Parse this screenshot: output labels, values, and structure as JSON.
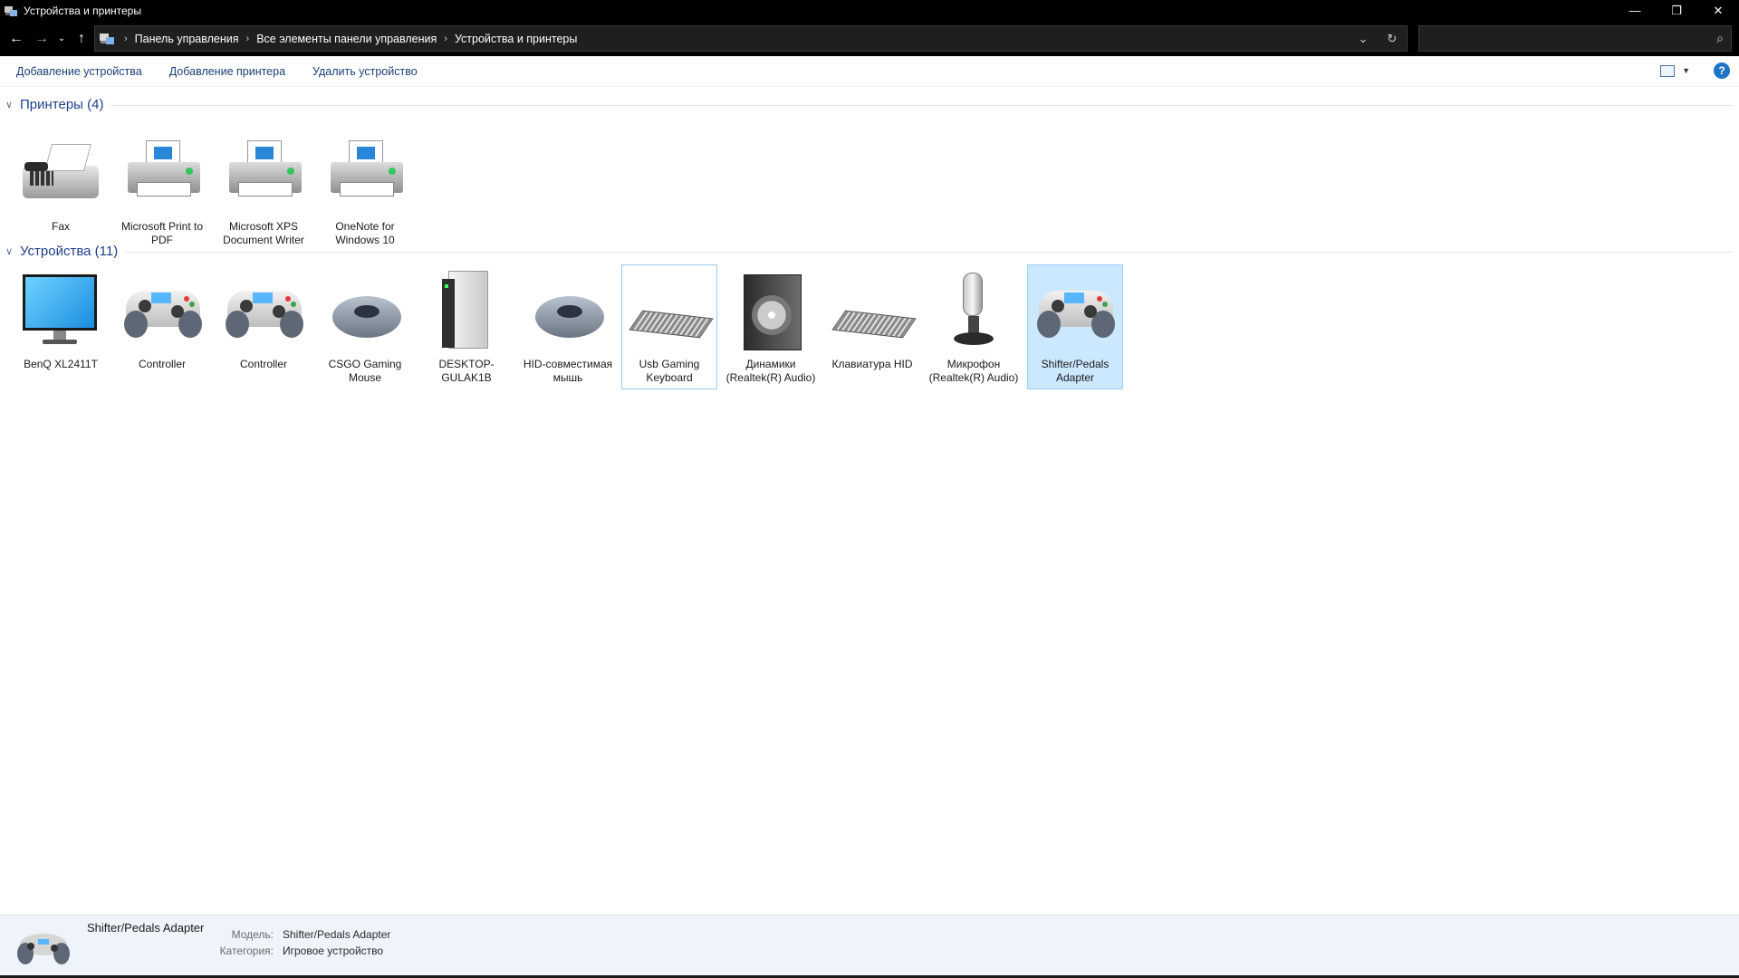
{
  "window": {
    "title": "Устройства и принтеры",
    "controls": {
      "minimize": "—",
      "restore": "❐",
      "close": "✕"
    }
  },
  "address_bar": {
    "breadcrumbs": [
      "Панель управления",
      "Все элементы панели управления",
      "Устройства и принтеры"
    ],
    "separator": "›",
    "search_placeholder": ""
  },
  "command_bar": {
    "add_device": "Добавление устройства",
    "add_printer": "Добавление принтера",
    "remove_device": "Удалить устройство",
    "help": "?"
  },
  "groups": {
    "printers": {
      "label": "Принтеры (4)",
      "items": [
        {
          "label": "Fax",
          "icon": "fax-icon"
        },
        {
          "label": "Microsoft Print to PDF",
          "icon": "printer-icon"
        },
        {
          "label": "Microsoft XPS Document Writer",
          "icon": "printer-icon"
        },
        {
          "label": "OneNote for Windows 10",
          "icon": "printer-icon"
        }
      ]
    },
    "devices": {
      "label": "Устройства (11)",
      "items": [
        {
          "label": "BenQ XL2411T",
          "icon": "monitor-icon"
        },
        {
          "label": "Controller",
          "icon": "gamepad-icon"
        },
        {
          "label": "Controller",
          "icon": "gamepad-icon"
        },
        {
          "label": "CSGO Gaming Mouse",
          "icon": "mouse-icon"
        },
        {
          "label": "DESKTOP-GULAK1B",
          "icon": "computer-tower-icon"
        },
        {
          "label": "HID-совместимая мышь",
          "icon": "mouse-icon"
        },
        {
          "label": "Usb Gaming Keyboard",
          "icon": "keyboard-icon",
          "state": "focused"
        },
        {
          "label": "Динамики (Realtek(R) Audio)",
          "icon": "speaker-icon"
        },
        {
          "label": "Клавиатура HID",
          "icon": "keyboard-icon"
        },
        {
          "label": "Микрофон (Realtek(R) Audio)",
          "icon": "microphone-icon"
        },
        {
          "label": "Shifter/Pedals Adapter",
          "icon": "gamepad-icon",
          "state": "selected"
        }
      ]
    }
  },
  "details": {
    "name": "Shifter/Pedals Adapter",
    "model_label": "Модель:",
    "model_value": "Shifter/Pedals Adapter",
    "category_label": "Категория:",
    "category_value": "Игровое устройство"
  },
  "colors": {
    "selection_bg": "#cce8ff",
    "link": "#1a3e78",
    "group_header": "#1e3f8a"
  }
}
